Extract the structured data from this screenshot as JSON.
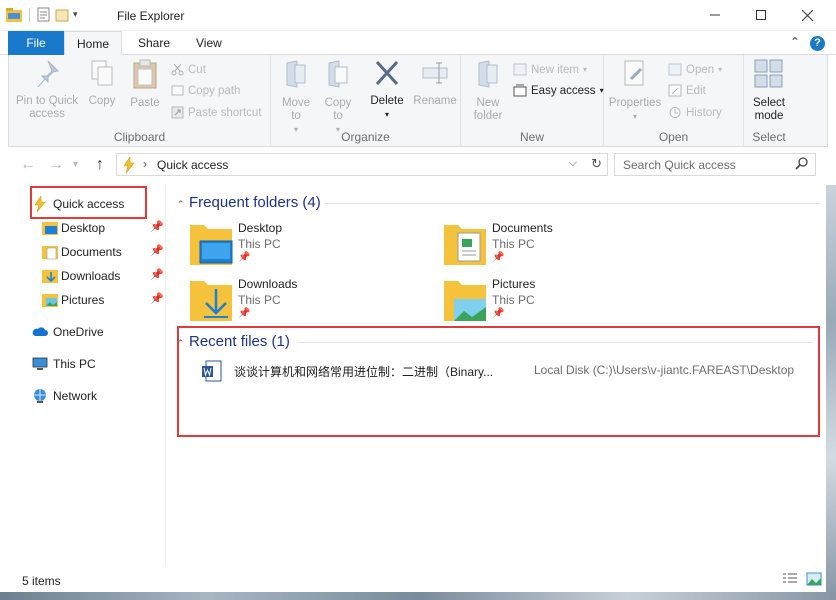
{
  "window": {
    "title": "File Explorer"
  },
  "ribbon_tabs": {
    "file": "File",
    "home": "Home",
    "share": "Share",
    "view": "View"
  },
  "ribbon": {
    "clipboard": {
      "label": "Clipboard",
      "pin_to_quick_access": "Pin to Quick access",
      "copy": "Copy",
      "paste": "Paste",
      "cut": "Cut",
      "copy_path": "Copy path",
      "paste_shortcut": "Paste shortcut"
    },
    "organize": {
      "label": "Organize",
      "move_to": "Move to",
      "copy_to": "Copy to",
      "delete": "Delete",
      "rename": "Rename"
    },
    "new": {
      "label": "New",
      "new_folder": "New folder",
      "new_item": "New item",
      "easy_access": "Easy access"
    },
    "open": {
      "label": "Open",
      "properties": "Properties",
      "open": "Open",
      "edit": "Edit",
      "history": "History"
    },
    "select": {
      "label": "Select",
      "select_mode": "Select mode"
    }
  },
  "address": {
    "current": "Quick access",
    "search_placeholder": "Search Quick access"
  },
  "nav_pane": {
    "items": [
      {
        "label": "Quick access",
        "icon": "lightning-icon"
      },
      {
        "label": "Desktop",
        "icon": "desktop-folder-icon",
        "pinned": true
      },
      {
        "label": "Documents",
        "icon": "documents-folder-icon",
        "pinned": true
      },
      {
        "label": "Downloads",
        "icon": "downloads-folder-icon",
        "pinned": true
      },
      {
        "label": "Pictures",
        "icon": "pictures-folder-icon",
        "pinned": true
      },
      {
        "label": "OneDrive",
        "icon": "cloud-icon"
      },
      {
        "label": "This PC",
        "icon": "computer-icon"
      },
      {
        "label": "Network",
        "icon": "network-icon"
      }
    ]
  },
  "content": {
    "frequent_title": "Frequent folders (4)",
    "frequent": [
      {
        "name": "Desktop",
        "location": "This PC"
      },
      {
        "name": "Documents",
        "location": "This PC"
      },
      {
        "name": "Downloads",
        "location": "This PC"
      },
      {
        "name": "Pictures",
        "location": "This PC"
      }
    ],
    "recent_title": "Recent files (1)",
    "recent": [
      {
        "name": "谈谈计算机和网络常用进位制：二进制（Binary...",
        "path": "Local Disk (C:)\\Users\\v-jiantc.FAREAST\\Desktop"
      }
    ]
  },
  "status": {
    "items_count": "5 items"
  },
  "colors": {
    "accent": "#1979ca",
    "highlight_border": "#e03a3a",
    "section_title": "#1e3287",
    "folder_yellow": "#f5c33b"
  }
}
